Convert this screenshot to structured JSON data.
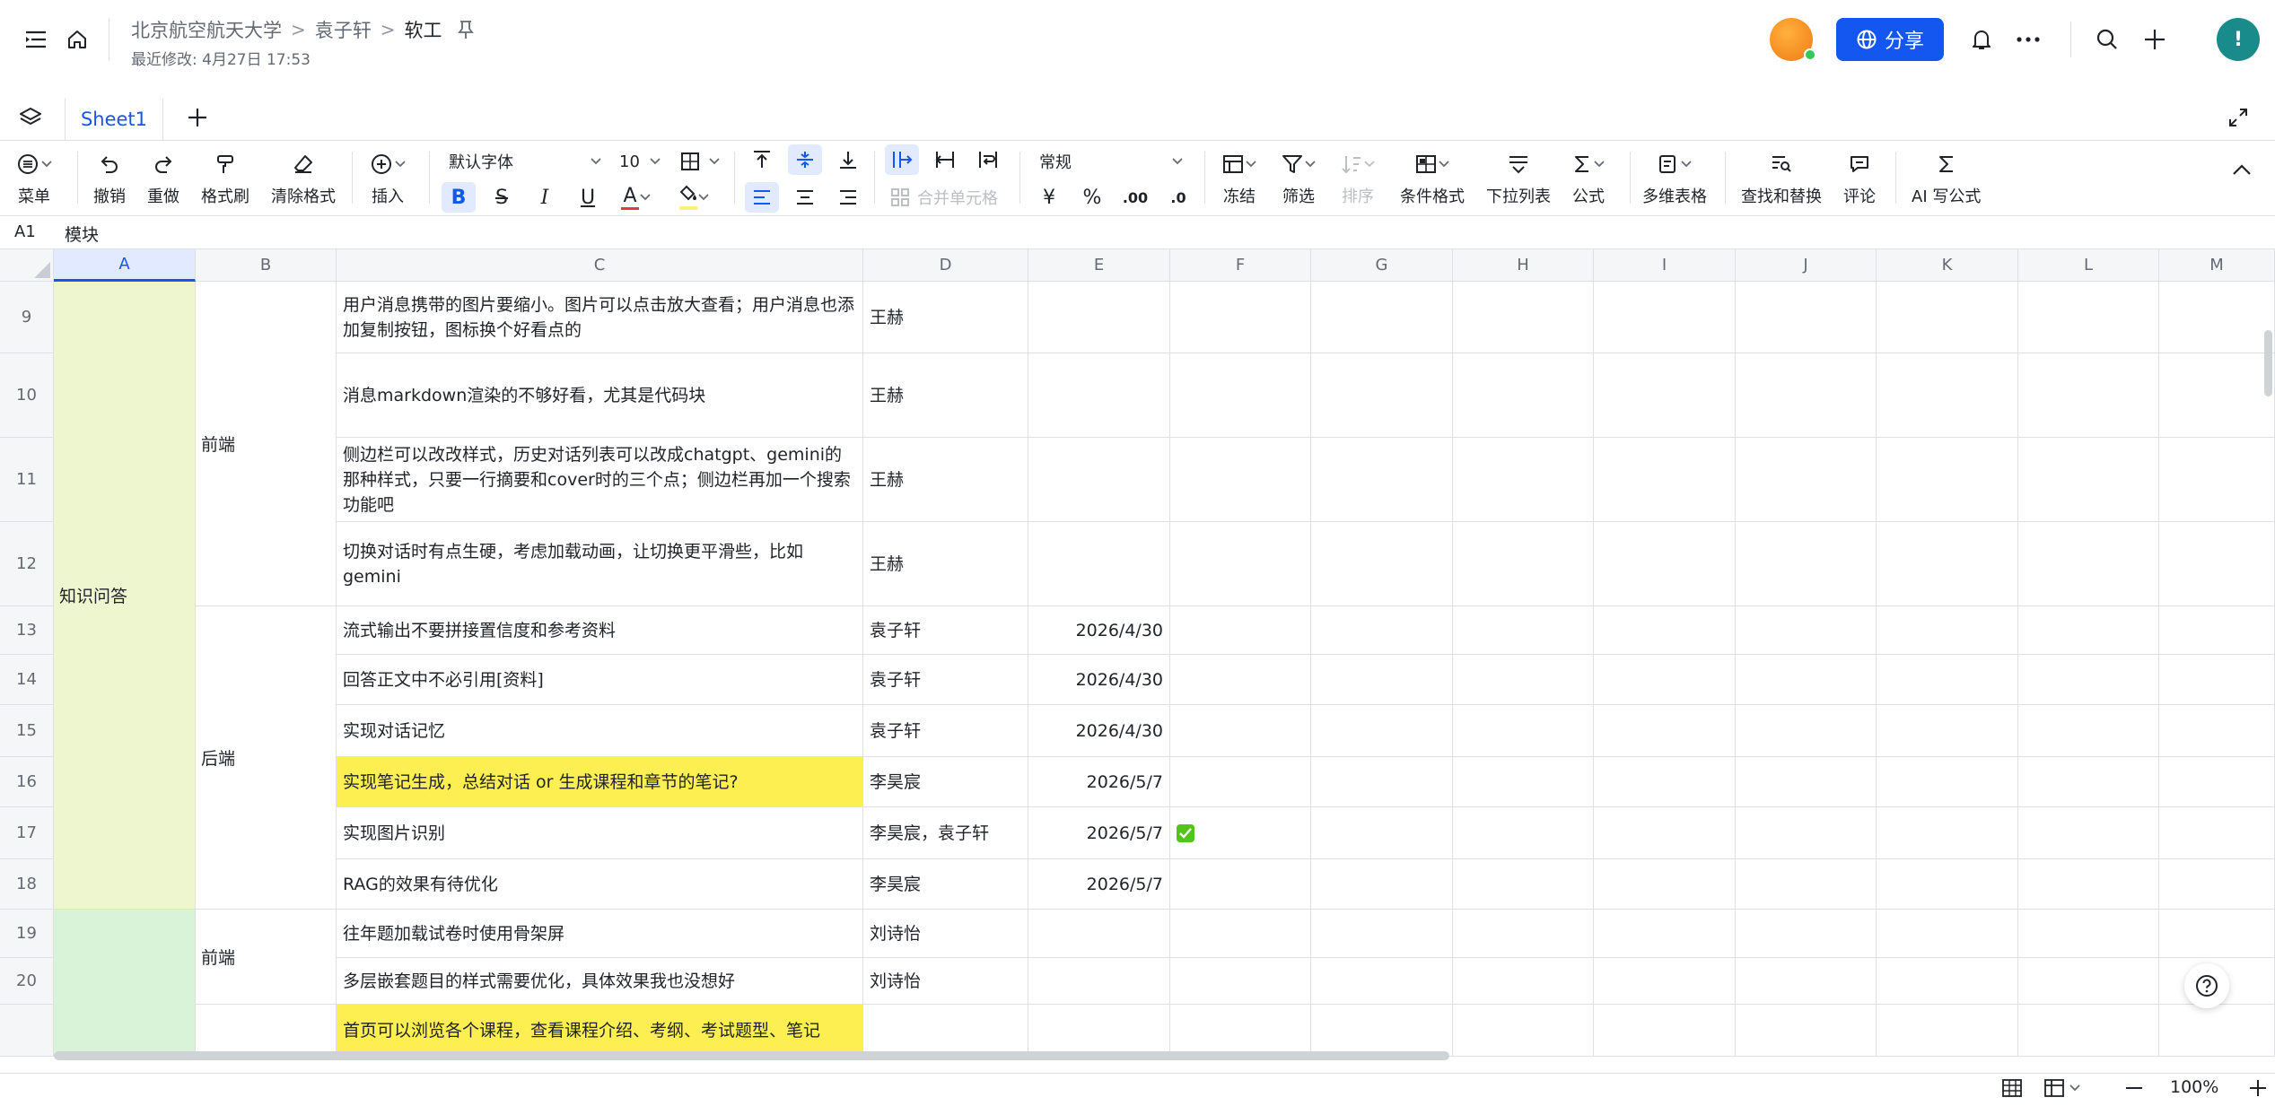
{
  "header": {
    "breadcrumbs": [
      "北京航空航天大学",
      "袁子轩"
    ],
    "current_doc": "软工",
    "last_modified": "最近修改: 4月27日 17:53",
    "share_label": "分享",
    "user_initial": "!"
  },
  "tabs": {
    "sheets": [
      "Sheet1"
    ]
  },
  "toolbar": {
    "menu": "菜单",
    "undo": "撤销",
    "redo": "重做",
    "format_painter": "格式刷",
    "clear_format": "清除格式",
    "insert": "插入",
    "font_family": "默认字体",
    "font_size": "10",
    "merge_cells": "合并单元格",
    "number_format": "常规",
    "freeze": "冻结",
    "filter": "筛选",
    "sort": "排序",
    "conditional_format": "条件格式",
    "dropdown_list": "下拉列表",
    "formula": "公式",
    "multi_table": "多维表格",
    "find_replace": "查找和替换",
    "comment": "评论",
    "ai_formula": "AI 写公式",
    "text_color": "#e53935",
    "fill_color": "#fff176"
  },
  "formula_bar": {
    "cell_ref": "A1",
    "content": "模块"
  },
  "grid": {
    "columns": [
      "A",
      "B",
      "C",
      "D",
      "E",
      "F",
      "G",
      "H",
      "I",
      "J",
      "K",
      "L",
      "M"
    ],
    "active_column": "A",
    "rows": [
      {
        "num": "9",
        "c": "用户消息携带的图片要缩小。图片可以点击放大查看；用户消息也添加复制按钮，图标换个好看点的",
        "d": "王赫",
        "e": "",
        "f_check": false,
        "highlight": false
      },
      {
        "num": "10",
        "c": "消息markdown渲染的不够好看，尤其是代码块",
        "d": "王赫",
        "e": "",
        "f_check": false,
        "highlight": false
      },
      {
        "num": "11",
        "c": "侧边栏可以改改样式，历史对话列表可以改成chatgpt、gemini的那种样式，只要一行摘要和cover时的三个点；侧边栏再加一个搜索功能吧",
        "d": "王赫",
        "e": "",
        "f_check": false,
        "highlight": false
      },
      {
        "num": "12",
        "c": "切换对话时有点生硬，考虑加载动画，让切换更平滑些，比如gemini",
        "d": "王赫",
        "e": "",
        "f_check": false,
        "highlight": false
      },
      {
        "num": "13",
        "c": "流式输出不要拼接置信度和参考资料",
        "d": "袁子轩",
        "e": "2026/4/30",
        "f_check": false,
        "highlight": false
      },
      {
        "num": "14",
        "c": "回答正文中不必引用[资料]",
        "d": "袁子轩",
        "e": "2026/4/30",
        "f_check": false,
        "highlight": false
      },
      {
        "num": "15",
        "c": "实现对话记忆",
        "d": "袁子轩",
        "e": "2026/4/30",
        "f_check": false,
        "highlight": false
      },
      {
        "num": "16",
        "c": "实现笔记生成，总结对话 or 生成课程和章节的笔记?",
        "d": "李昊宸",
        "e": "2026/5/7",
        "f_check": false,
        "highlight": true
      },
      {
        "num": "17",
        "c": "实现图片识别",
        "d": "李昊宸，袁子轩",
        "e": "2026/5/7",
        "f_check": true,
        "highlight": false
      },
      {
        "num": "18",
        "c": "RAG的效果有待优化",
        "d": "李昊宸",
        "e": "2026/5/7",
        "f_check": false,
        "highlight": false
      },
      {
        "num": "19",
        "c": "往年题加载试卷时使用骨架屏",
        "d": "刘诗怡",
        "e": "",
        "f_check": false,
        "highlight": false
      },
      {
        "num": "20",
        "c": "多层嵌套题目的样式需要优化，具体效果我也没想好",
        "d": "刘诗怡",
        "e": "",
        "f_check": false,
        "highlight": false
      },
      {
        "num": "",
        "c": "首页可以浏览各个课程，查看课程介绍、考纲、考试题型、笔记",
        "d": "",
        "e": "",
        "f_check": false,
        "highlight": true
      }
    ],
    "merged": {
      "a_knowledge": "知识问答",
      "b_frontend_1": "前端",
      "b_backend": "后端",
      "b_frontend_2": "前端"
    },
    "colors": {
      "knowledge_fill": "#eef6d0",
      "second_module_fill": "#d9f3d9",
      "highlight_fill": "#fdee52",
      "check_color": "#52c41a"
    }
  },
  "status": {
    "zoom": "100%"
  }
}
